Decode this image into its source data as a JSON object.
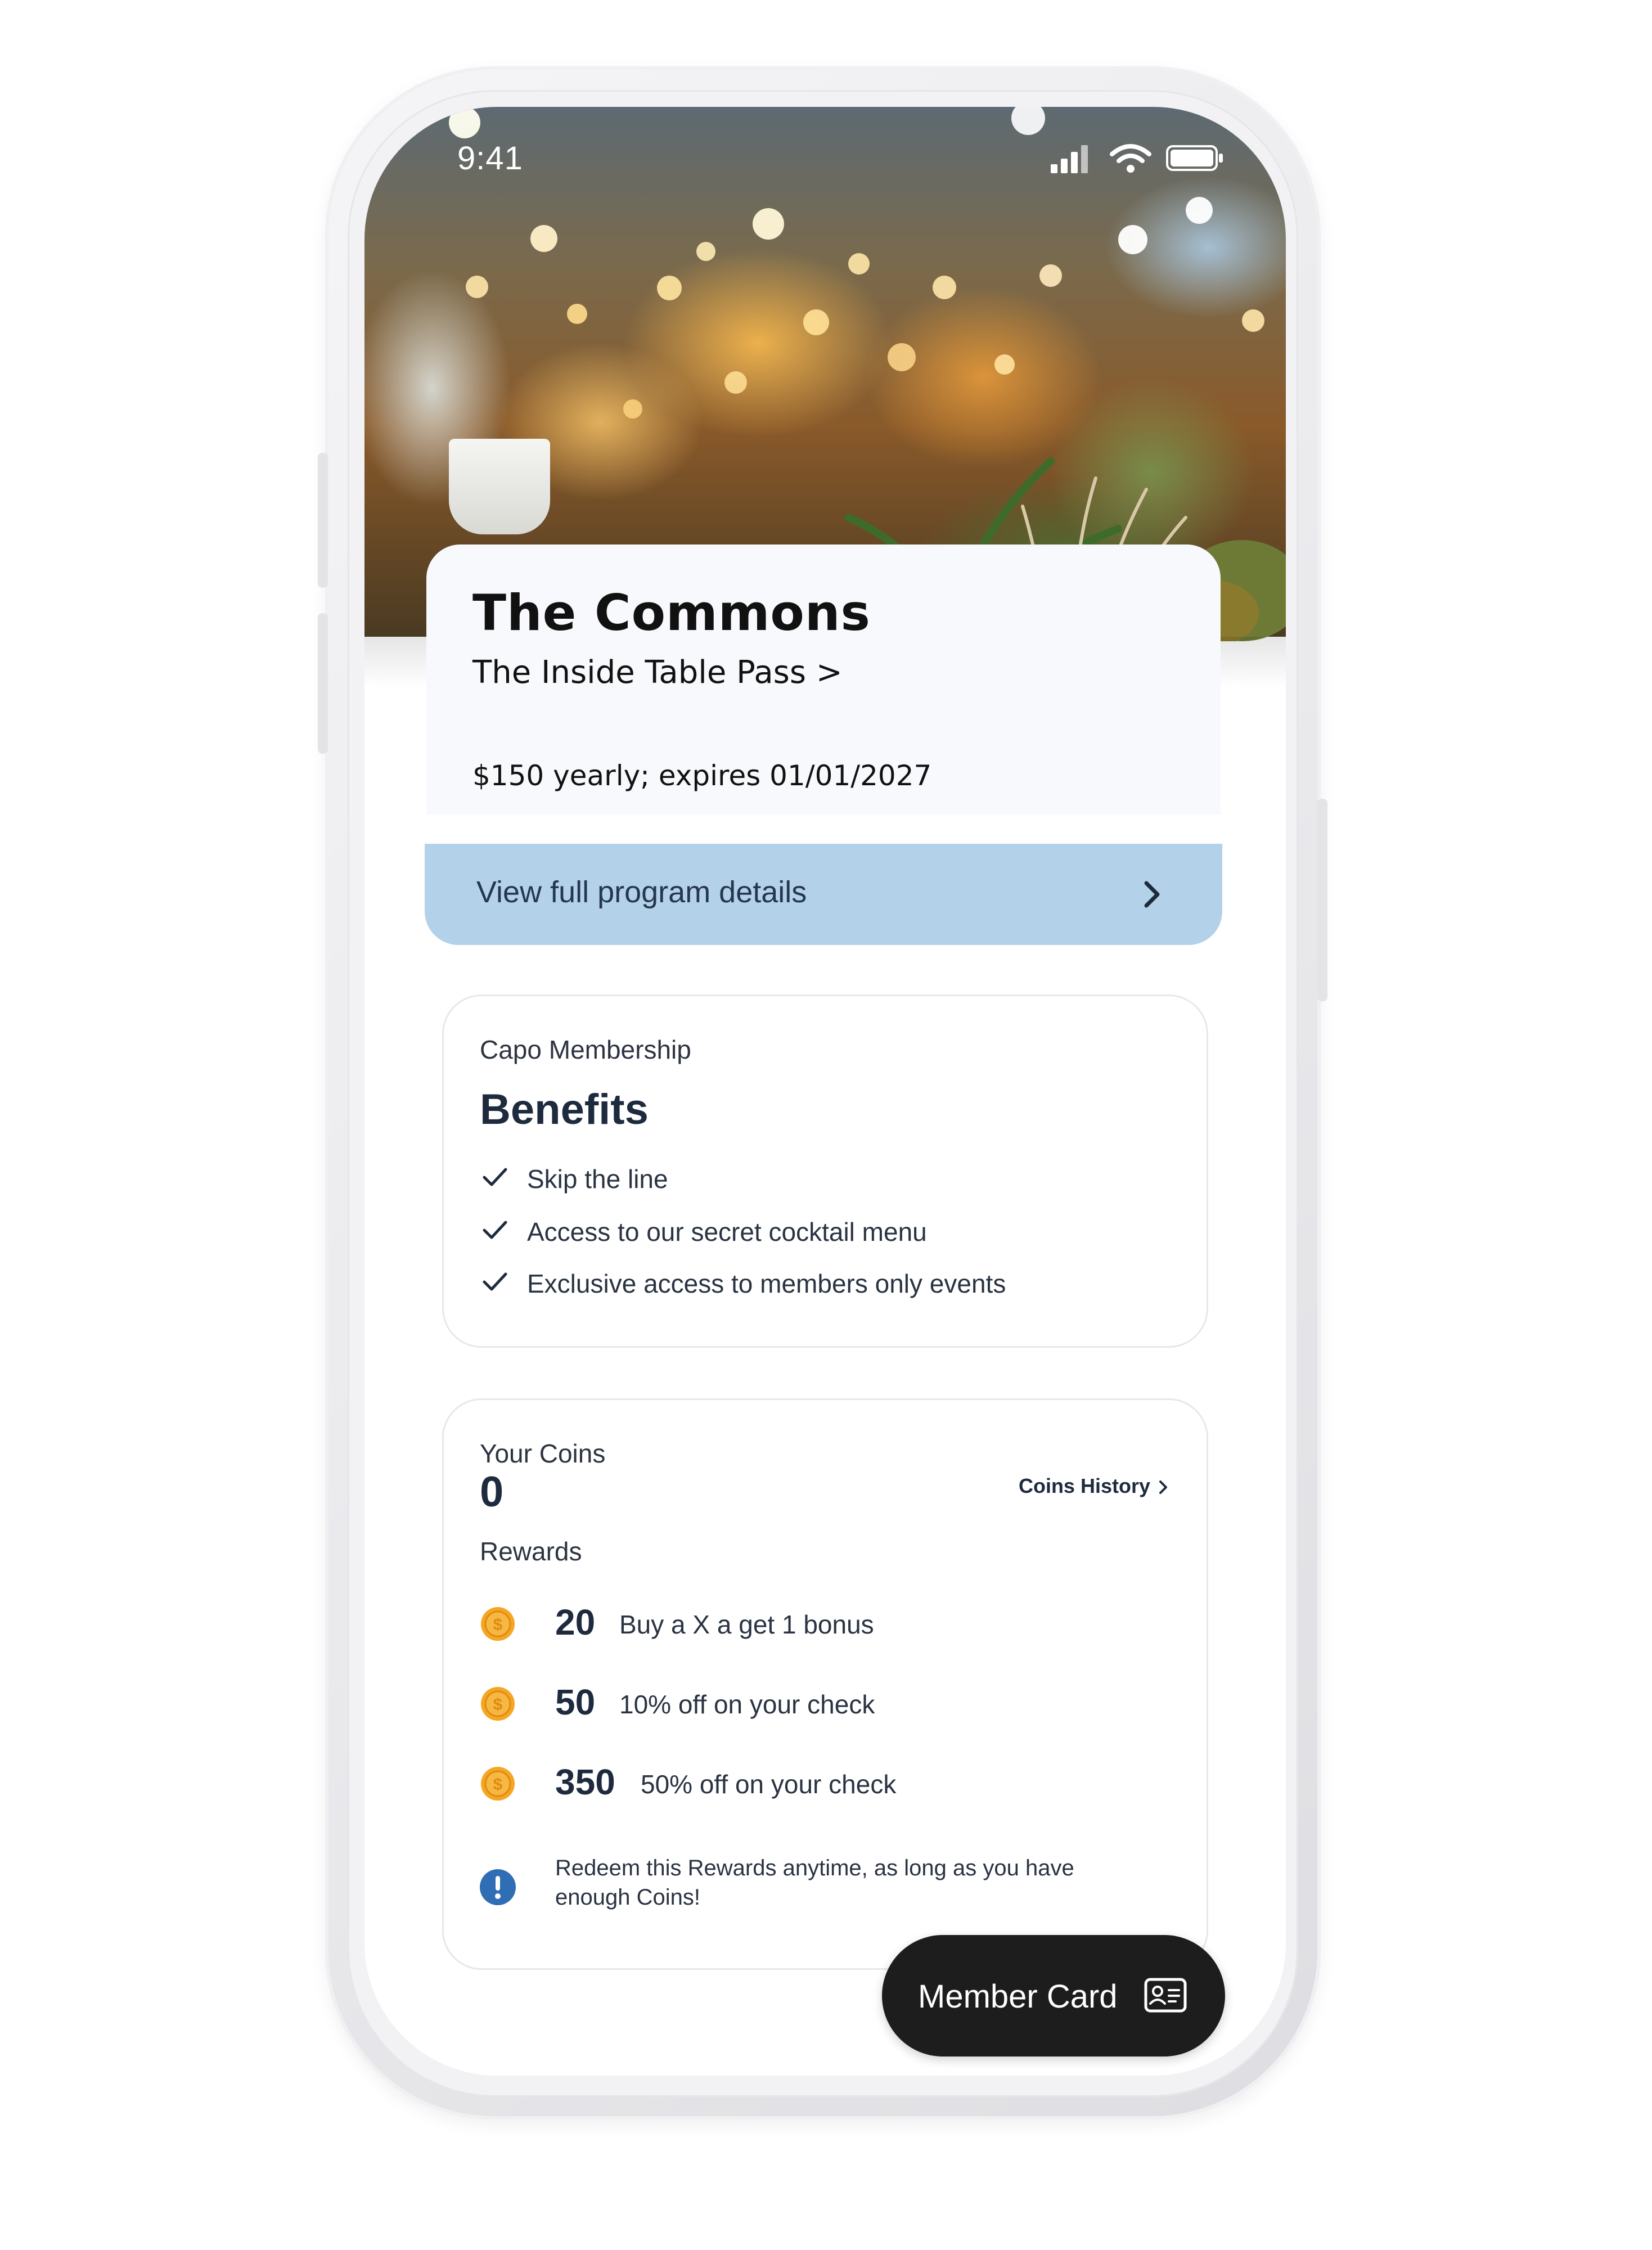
{
  "status_bar": {
    "time": "9:41",
    "icons": [
      "signal-icon",
      "wifi-icon",
      "battery-icon"
    ]
  },
  "hero": {
    "image_description": "blurred restaurant terrace with warm bokeh lights and plants"
  },
  "venue": {
    "name": "The Commons",
    "pass_link": "The Inside Table Pass >",
    "price_line": "$150 yearly; expires 01/01/2027"
  },
  "program_details": {
    "label": "View full program details",
    "icon": "chevron-right-icon"
  },
  "benefits": {
    "kicker": "Capo Membership",
    "title": "Benefits",
    "items": [
      {
        "label": "Skip the line",
        "icon": "check-icon"
      },
      {
        "label": "Access to our secret cocktail menu",
        "icon": "check-icon"
      },
      {
        "label": "Exclusive access to members only events",
        "icon": "check-icon"
      }
    ]
  },
  "coins": {
    "kicker": "Your Coins",
    "count": "0",
    "history_label": "Coins History",
    "rewards_label": "Rewards",
    "rewards": [
      {
        "cost": "20",
        "description": "Buy a X a get 1 bonus",
        "icon": "coin-icon"
      },
      {
        "cost": "50",
        "description": "10% off on your check",
        "icon": "coin-icon"
      },
      {
        "cost": "350",
        "description": "50% off on your check",
        "icon": "coin-icon"
      }
    ],
    "info_text": "Redeem this Rewards anytime, as long as you have enough Coins!",
    "info_icon": "info-icon"
  },
  "member_card": {
    "label": "Member Card",
    "icon": "id-card-icon"
  },
  "colors": {
    "details_bar": "#b4d1ea",
    "dark_text": "#1e2a3e",
    "fab_background": "#1d1d1d",
    "coin": "#f5a623",
    "info": "#2f6db5"
  }
}
